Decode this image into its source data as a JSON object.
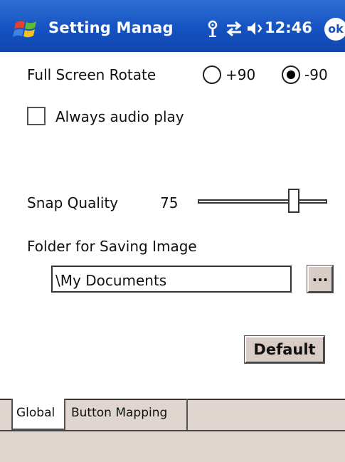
{
  "titlebar": {
    "app_title": "Setting Manag",
    "clock": "12:46",
    "ok_label": "ok",
    "icons": [
      "windows-start-icon",
      "signal-antenna-icon",
      "connectivity-arrows-icon",
      "speaker-volume-icon"
    ]
  },
  "settings": {
    "rotate_label": "Full Screen Rotate",
    "rotate_options": [
      {
        "label": "+90",
        "selected": false
      },
      {
        "label": "-90",
        "selected": true
      }
    ],
    "audio_label": "Always audio play",
    "audio_checked": false,
    "snap_label": "Snap Quality",
    "snap_value": "75",
    "snap_slider_fraction": 0.75,
    "folder_label": "Folder for Saving Image",
    "folder_value": "\\My Documents",
    "browse_label": "...",
    "default_label": "Default"
  },
  "tabs": [
    {
      "label": "Global",
      "active": true
    },
    {
      "label": "Button Mapping",
      "active": false
    }
  ],
  "colors": {
    "titlebar": "#1552c2",
    "chrome": "#e1d6cf",
    "button_face": "#d8ccc4"
  }
}
